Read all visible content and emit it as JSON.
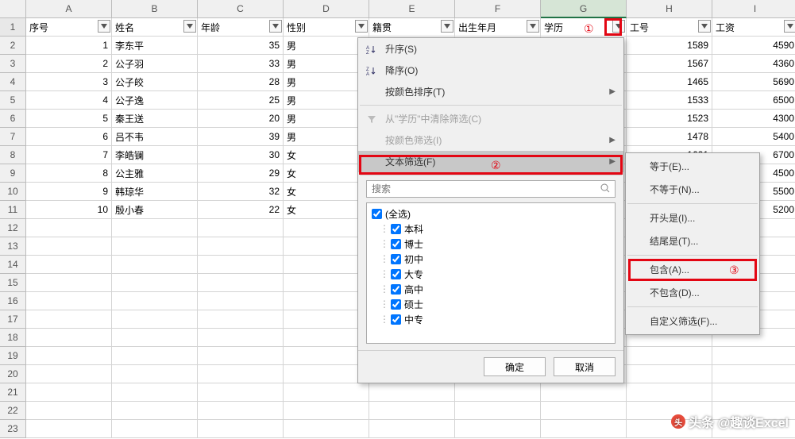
{
  "columns": [
    "A",
    "B",
    "C",
    "D",
    "E",
    "F",
    "G",
    "H",
    "I"
  ],
  "headers": [
    "序号",
    "姓名",
    "年龄",
    "性别",
    "籍贯",
    "出生年月",
    "学历",
    "工号",
    "工资"
  ],
  "rows": [
    {
      "n": "1",
      "name": "李东平",
      "age": "35",
      "sex": "男",
      "id": "1589",
      "sal": "4590"
    },
    {
      "n": "2",
      "name": "公子羽",
      "age": "33",
      "sex": "男",
      "id": "1567",
      "sal": "4360"
    },
    {
      "n": "3",
      "name": "公子皎",
      "age": "28",
      "sex": "男",
      "id": "1465",
      "sal": "5690"
    },
    {
      "n": "4",
      "name": "公子逸",
      "age": "25",
      "sex": "男",
      "id": "1533",
      "sal": "6500"
    },
    {
      "n": "5",
      "name": "秦王送",
      "age": "20",
      "sex": "男",
      "id": "1523",
      "sal": "4300"
    },
    {
      "n": "6",
      "name": "吕不韦",
      "age": "39",
      "sex": "男",
      "id": "1478",
      "sal": "5400"
    },
    {
      "n": "7",
      "name": "李皓镧",
      "age": "30",
      "sex": "女",
      "id": "1621",
      "sal": "6700"
    },
    {
      "n": "8",
      "name": "公主雅",
      "age": "29",
      "sex": "女",
      "id": "",
      "sal": "4500"
    },
    {
      "n": "9",
      "name": "韩琼华",
      "age": "32",
      "sex": "女",
      "id": "",
      "sal": "5500"
    },
    {
      "n": "10",
      "name": "殷小春",
      "age": "22",
      "sex": "女",
      "id": "",
      "sal": "5200"
    }
  ],
  "totalRows": 23,
  "dropdown": {
    "sortAsc": "升序(S)",
    "sortDesc": "降序(O)",
    "sortColor": "按颜色排序(T)",
    "clearFilter": "从\"学历\"中清除筛选(C)",
    "filterColor": "按颜色筛选(I)",
    "textFilter": "文本筛选(F)",
    "searchPlaceholder": "搜索",
    "checks": [
      "(全选)",
      "本科",
      "博士",
      "初中",
      "大专",
      "高中",
      "硕士",
      "中专"
    ],
    "ok": "确定",
    "cancel": "取消"
  },
  "submenu": {
    "eq": "等于(E)...",
    "neq": "不等于(N)...",
    "begins": "开头是(I)...",
    "ends": "结尾是(T)...",
    "contains": "包含(A)...",
    "notcontains": "不包含(D)...",
    "custom": "自定义筛选(F)..."
  },
  "annotations": {
    "a1": "①",
    "a2": "②",
    "a3": "③"
  },
  "watermark": "头条 @趣谈Excel"
}
